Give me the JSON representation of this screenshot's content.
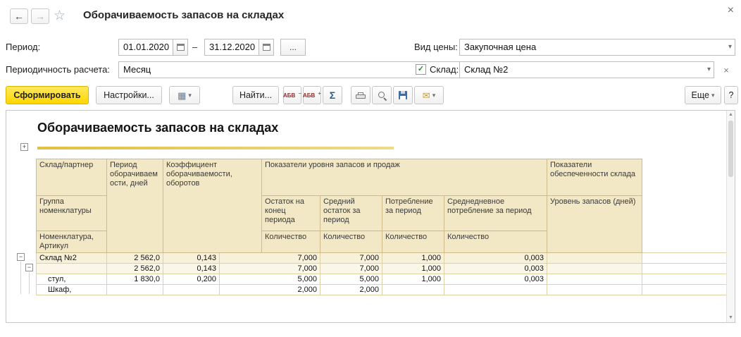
{
  "icons": {
    "back": "←",
    "forward": "→",
    "star": "☆",
    "close": "×",
    "chevron_down": "▾",
    "ellipsis": "...",
    "dash": "–",
    "sigma": "Σ",
    "mail": "✉",
    "check": "✓",
    "grid": "▦",
    "abc": "АБВ",
    "plus": "+",
    "minus": "−",
    "scroll_up": "▲",
    "scroll_down": "▼"
  },
  "window": {
    "title": "Оборачиваемость запасов на складах"
  },
  "filters": {
    "period_label": "Период:",
    "date_from": "01.01.2020",
    "date_to": "31.12.2020",
    "periodicity_label": "Периодичность расчета:",
    "periodicity_value": "Месяц",
    "price_type_label": "Вид цены:",
    "price_type_value": "Закупочная цена",
    "warehouse_label": "Склад:",
    "warehouse_value": "Склад №2"
  },
  "toolbar": {
    "generate": "Сформировать",
    "settings": "Настройки...",
    "find": "Найти...",
    "more": "Еще",
    "help": "?"
  },
  "report": {
    "title": "Оборачиваемость запасов на складах",
    "header": {
      "warehouse_partner": "Склад/партнер",
      "group": "Группа номенклатуры",
      "nomenclature": "Номенклатура, Артикул",
      "turnover_period": "Период оборачиваемости, дней",
      "turnover_ratio": "Коэффициент оборачиваемости, оборотов",
      "stock_sales": "Показатели уровня запасов и продаж",
      "end_balance": "Остаток на конец периода",
      "avg_balance": "Средний остаток за период",
      "consumption": "Потребление за период",
      "avg_daily": "Среднедневное потребление за период",
      "supply": "Показатели обеспеченности склада",
      "stock_level": "Уровень запасов (дней)",
      "quantity": "Количество"
    },
    "rows": [
      {
        "name": "Склад №2",
        "period": "2 562,0",
        "ratio": "0,143",
        "end_balance": "7,000",
        "avg_balance": "7,000",
        "consumption": "1,000",
        "avg_daily": "0,003",
        "level": ""
      },
      {
        "name": "",
        "period": "2 562,0",
        "ratio": "0,143",
        "end_balance": "7,000",
        "avg_balance": "7,000",
        "consumption": "1,000",
        "avg_daily": "0,003",
        "level": ""
      },
      {
        "name": "стул,",
        "period": "1 830,0",
        "ratio": "0,200",
        "end_balance": "5,000",
        "avg_balance": "5,000",
        "consumption": "1,000",
        "avg_daily": "0,003",
        "level": ""
      },
      {
        "name": "Шкаф,",
        "period": "",
        "ratio": "",
        "end_balance": "2,000",
        "avg_balance": "2,000",
        "consumption": "",
        "avg_daily": "",
        "level": ""
      }
    ]
  },
  "colors": {
    "accent_yellow": "#ffd600",
    "header_bg": "#f3e8c5",
    "header_border": "#cdbb8a",
    "title_underline": "#e3bf3d"
  }
}
